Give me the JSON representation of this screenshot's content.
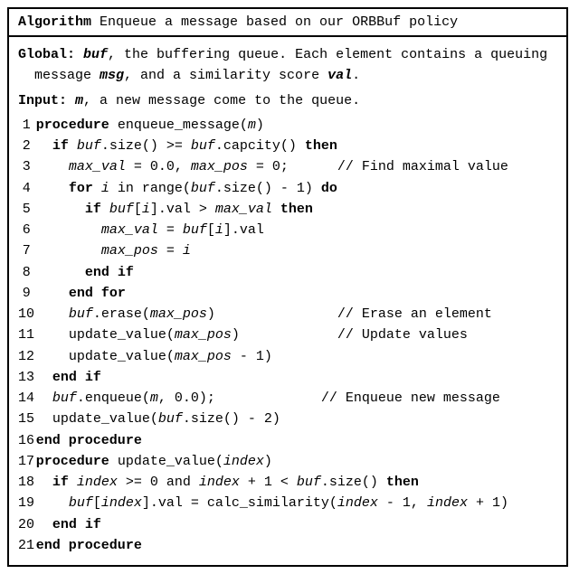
{
  "title": {
    "label": "Algorithm",
    "text": " Enqueue a message based on our ORBBuf policy"
  },
  "prelude": {
    "global_label": "Global:",
    "global_text_1": " ",
    "global_var": "buf",
    "global_text_2": ", the buffering queue. Each element contains a queuing message ",
    "global_var2": "msg",
    "global_text_3": ", and a similarity score ",
    "global_var3": "val",
    "global_text_4": ".",
    "input_label": "Input:",
    "input_var": "m",
    "input_text": ", a new message come to the queue."
  },
  "lines": [
    {
      "n": "1",
      "indent": 0,
      "parts": [
        {
          "t": "procedure ",
          "c": "kw"
        },
        {
          "t": "enqueue_message(",
          "c": ""
        },
        {
          "t": "m",
          "c": "em"
        },
        {
          "t": ")",
          "c": ""
        }
      ]
    },
    {
      "n": "2",
      "indent": 1,
      "parts": [
        {
          "t": "if ",
          "c": "kw"
        },
        {
          "t": "buf",
          "c": "em"
        },
        {
          "t": ".size() >= ",
          "c": ""
        },
        {
          "t": "buf",
          "c": "em"
        },
        {
          "t": ".capcity() ",
          "c": ""
        },
        {
          "t": "then",
          "c": "kw"
        }
      ]
    },
    {
      "n": "3",
      "indent": 2,
      "parts": [
        {
          "t": "max_val",
          "c": "em"
        },
        {
          "t": " = 0.0, ",
          "c": ""
        },
        {
          "t": "max_pos",
          "c": "em"
        },
        {
          "t": " = 0;      // Find maximal value",
          "c": ""
        }
      ]
    },
    {
      "n": "4",
      "indent": 2,
      "parts": [
        {
          "t": "for ",
          "c": "kw"
        },
        {
          "t": "i",
          "c": "em"
        },
        {
          "t": " in range(",
          "c": ""
        },
        {
          "t": "buf",
          "c": "em"
        },
        {
          "t": ".size() - 1) ",
          "c": ""
        },
        {
          "t": "do",
          "c": "kw"
        }
      ]
    },
    {
      "n": "5",
      "indent": 3,
      "parts": [
        {
          "t": "if ",
          "c": "kw"
        },
        {
          "t": "buf",
          "c": "em"
        },
        {
          "t": "[",
          "c": ""
        },
        {
          "t": "i",
          "c": "em"
        },
        {
          "t": "].val > ",
          "c": ""
        },
        {
          "t": "max_val",
          "c": "em"
        },
        {
          "t": " ",
          "c": ""
        },
        {
          "t": "then",
          "c": "kw"
        }
      ]
    },
    {
      "n": "6",
      "indent": 4,
      "parts": [
        {
          "t": "max_val",
          "c": "em"
        },
        {
          "t": " = ",
          "c": ""
        },
        {
          "t": "buf",
          "c": "em"
        },
        {
          "t": "[",
          "c": ""
        },
        {
          "t": "i",
          "c": "em"
        },
        {
          "t": "].val",
          "c": ""
        }
      ]
    },
    {
      "n": "7",
      "indent": 4,
      "parts": [
        {
          "t": "max_pos",
          "c": "em"
        },
        {
          "t": " = ",
          "c": ""
        },
        {
          "t": "i",
          "c": "em"
        }
      ]
    },
    {
      "n": "8",
      "indent": 3,
      "parts": [
        {
          "t": "end if",
          "c": "kw"
        }
      ]
    },
    {
      "n": "9",
      "indent": 2,
      "parts": [
        {
          "t": "end for",
          "c": "kw"
        }
      ]
    },
    {
      "n": "10",
      "indent": 2,
      "parts": [
        {
          "t": "buf",
          "c": "em"
        },
        {
          "t": ".erase(",
          "c": ""
        },
        {
          "t": "max_pos",
          "c": "em"
        },
        {
          "t": ")               // Erase an element",
          "c": ""
        }
      ]
    },
    {
      "n": "11",
      "indent": 2,
      "parts": [
        {
          "t": "update_value(",
          "c": ""
        },
        {
          "t": "max_pos",
          "c": "em"
        },
        {
          "t": ")            // Update values",
          "c": ""
        }
      ]
    },
    {
      "n": "12",
      "indent": 2,
      "parts": [
        {
          "t": "update_value(",
          "c": ""
        },
        {
          "t": "max_pos",
          "c": "em"
        },
        {
          "t": " - 1)",
          "c": ""
        }
      ]
    },
    {
      "n": "13",
      "indent": 1,
      "parts": [
        {
          "t": "end if",
          "c": "kw"
        }
      ]
    },
    {
      "n": "14",
      "indent": 1,
      "parts": [
        {
          "t": "buf",
          "c": "em"
        },
        {
          "t": ".enqueue(",
          "c": ""
        },
        {
          "t": "m",
          "c": "em"
        },
        {
          "t": ", 0.0);             // Enqueue new message",
          "c": ""
        }
      ]
    },
    {
      "n": "15",
      "indent": 1,
      "parts": [
        {
          "t": "update_value(",
          "c": ""
        },
        {
          "t": "buf",
          "c": "em"
        },
        {
          "t": ".size() - 2)",
          "c": ""
        }
      ]
    },
    {
      "n": "16",
      "indent": 0,
      "parts": [
        {
          "t": "end procedure",
          "c": "kw"
        }
      ]
    },
    {
      "n": "17",
      "indent": 0,
      "parts": [
        {
          "t": "procedure ",
          "c": "kw"
        },
        {
          "t": "update_value(",
          "c": ""
        },
        {
          "t": "index",
          "c": "em"
        },
        {
          "t": ")",
          "c": ""
        }
      ]
    },
    {
      "n": "18",
      "indent": 1,
      "parts": [
        {
          "t": "if ",
          "c": "kw"
        },
        {
          "t": "index",
          "c": "em"
        },
        {
          "t": " >= 0 and ",
          "c": ""
        },
        {
          "t": "index",
          "c": "em"
        },
        {
          "t": " + 1 < ",
          "c": ""
        },
        {
          "t": "buf",
          "c": "em"
        },
        {
          "t": ".size() ",
          "c": ""
        },
        {
          "t": "then",
          "c": "kw"
        }
      ]
    },
    {
      "n": "19",
      "indent": 2,
      "parts": [
        {
          "t": "buf",
          "c": "em"
        },
        {
          "t": "[",
          "c": ""
        },
        {
          "t": "index",
          "c": "em"
        },
        {
          "t": "].val = calc_similarity(",
          "c": ""
        },
        {
          "t": "index",
          "c": "em"
        },
        {
          "t": " - 1, ",
          "c": ""
        },
        {
          "t": "index",
          "c": "em"
        },
        {
          "t": " + 1)",
          "c": ""
        }
      ]
    },
    {
      "n": "20",
      "indent": 1,
      "parts": [
        {
          "t": "end if",
          "c": "kw"
        }
      ]
    },
    {
      "n": "21",
      "indent": 0,
      "parts": [
        {
          "t": "end procedure",
          "c": "kw"
        }
      ]
    }
  ]
}
